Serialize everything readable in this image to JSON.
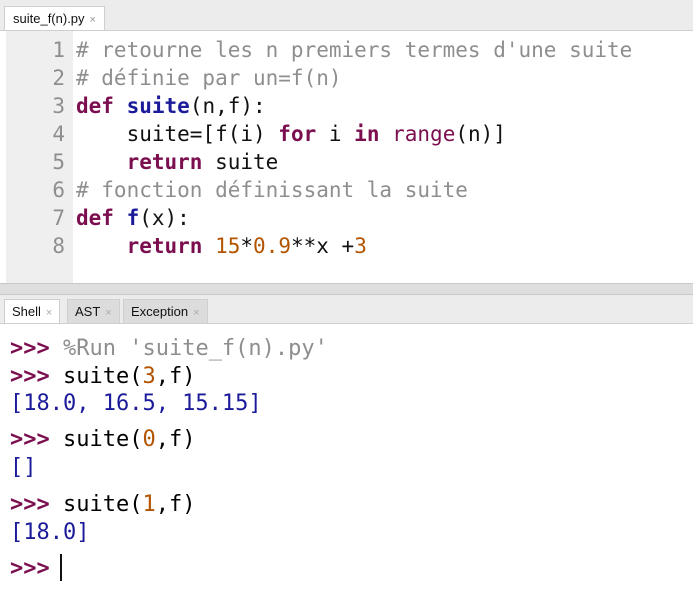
{
  "editor": {
    "tabs": [
      {
        "label": "suite_f(n).py",
        "close": "×"
      }
    ],
    "line_numbers": [
      "1",
      "2",
      "3",
      "4",
      "5",
      "6",
      "7",
      "8"
    ],
    "lines": [
      [
        {
          "t": "# retourne les n premiers termes d'une suite",
          "c": "cm"
        }
      ],
      [
        {
          "t": "# définie par un=f(n)",
          "c": "cm"
        }
      ],
      [
        {
          "t": "def",
          "c": "kw"
        },
        {
          "t": " ",
          "c": ""
        },
        {
          "t": "suite",
          "c": "fn"
        },
        {
          "t": "(n,f):",
          "c": ""
        }
      ],
      [
        {
          "t": "    suite=[f(i) ",
          "c": ""
        },
        {
          "t": "for",
          "c": "kw"
        },
        {
          "t": " i ",
          "c": ""
        },
        {
          "t": "in",
          "c": "kw"
        },
        {
          "t": " ",
          "c": ""
        },
        {
          "t": "range",
          "c": "bi"
        },
        {
          "t": "(n)]",
          "c": ""
        }
      ],
      [
        {
          "t": "    ",
          "c": ""
        },
        {
          "t": "return",
          "c": "kw"
        },
        {
          "t": " suite",
          "c": ""
        }
      ],
      [
        {
          "t": "# fonction définissant la suite",
          "c": "cm"
        }
      ],
      [
        {
          "t": "def",
          "c": "kw"
        },
        {
          "t": " ",
          "c": ""
        },
        {
          "t": "f",
          "c": "fn"
        },
        {
          "t": "(x):",
          "c": ""
        }
      ],
      [
        {
          "t": "    ",
          "c": ""
        },
        {
          "t": "return",
          "c": "kw"
        },
        {
          "t": " ",
          "c": ""
        },
        {
          "t": "15",
          "c": "nu"
        },
        {
          "t": "*",
          "c": ""
        },
        {
          "t": "0.9",
          "c": "nu"
        },
        {
          "t": "**x +",
          "c": ""
        },
        {
          "t": "3",
          "c": "nu"
        }
      ]
    ]
  },
  "shell_tabs": [
    {
      "label": "Shell",
      "close": "×"
    },
    {
      "label": "AST",
      "close": "×"
    },
    {
      "label": "Exception",
      "close": "×"
    }
  ],
  "shell": {
    "prompt": ">>>",
    "lines": [
      [
        {
          "t": ">>>",
          "c": "pr"
        },
        {
          "t": " %Run 'suite_f(n).py'",
          "c": "mg"
        }
      ],
      [
        {
          "t": ">>>",
          "c": "pr"
        },
        {
          "t": " suite(",
          "c": ""
        },
        {
          "t": "3",
          "c": "nu"
        },
        {
          "t": ",f)",
          "c": ""
        }
      ],
      [
        {
          "t": "[18.0, 16.5, 15.15]",
          "c": "out"
        }
      ],
      [
        {
          "t": ">>>",
          "c": "pr"
        },
        {
          "t": " suite(",
          "c": ""
        },
        {
          "t": "0",
          "c": "nu"
        },
        {
          "t": ",f)",
          "c": ""
        }
      ],
      [
        {
          "t": "[]",
          "c": "out"
        }
      ],
      [
        {
          "t": ">>>",
          "c": "pr"
        },
        {
          "t": " suite(",
          "c": ""
        },
        {
          "t": "1",
          "c": "nu"
        },
        {
          "t": ",f)",
          "c": ""
        }
      ],
      [
        {
          "t": "[18.0]",
          "c": "out"
        }
      ]
    ]
  },
  "colors": {
    "keyword": "#7b0e4f",
    "function_name": "#1b1b9a",
    "number": "#b35400",
    "comment": "#8e8e8e",
    "output": "#1b1b9a"
  }
}
